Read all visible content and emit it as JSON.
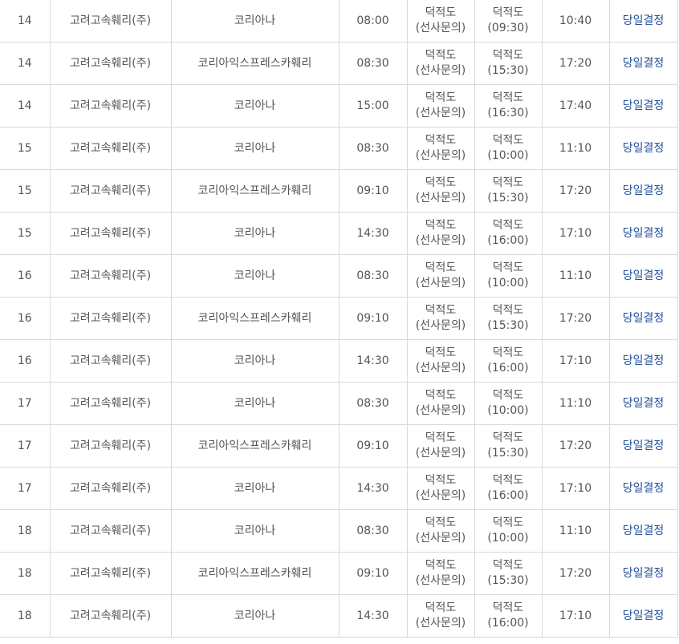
{
  "rows": [
    {
      "day": "14",
      "company": "고려고속훼리(주)",
      "ship": "코리아나",
      "depart": "08:00",
      "route_line1": "덕적도",
      "route_line2": "(선사문의)",
      "stop_line1": "덕적도",
      "stop_line2": "(09:30)",
      "return_time": "10:40",
      "note": "당일결정"
    },
    {
      "day": "14",
      "company": "고려고속훼리(주)",
      "ship": "코리아익스프레스카훼리",
      "depart": "08:30",
      "route_line1": "덕적도",
      "route_line2": "(선사문의)",
      "stop_line1": "덕적도",
      "stop_line2": "(15:30)",
      "return_time": "17:20",
      "note": "당일결정"
    },
    {
      "day": "14",
      "company": "고려고속훼리(주)",
      "ship": "코리아나",
      "depart": "15:00",
      "route_line1": "덕적도",
      "route_line2": "(선사문의)",
      "stop_line1": "덕적도",
      "stop_line2": "(16:30)",
      "return_time": "17:40",
      "note": "당일결정"
    },
    {
      "day": "15",
      "company": "고려고속훼리(주)",
      "ship": "코리아나",
      "depart": "08:30",
      "route_line1": "덕적도",
      "route_line2": "(선사문의)",
      "stop_line1": "덕적도",
      "stop_line2": "(10:00)",
      "return_time": "11:10",
      "note": "당일결정"
    },
    {
      "day": "15",
      "company": "고려고속훼리(주)",
      "ship": "코리아익스프레스카훼리",
      "depart": "09:10",
      "route_line1": "덕적도",
      "route_line2": "(선사문의)",
      "stop_line1": "덕적도",
      "stop_line2": "(15:30)",
      "return_time": "17:20",
      "note": "당일결정"
    },
    {
      "day": "15",
      "company": "고려고속훼리(주)",
      "ship": "코리아나",
      "depart": "14:30",
      "route_line1": "덕적도",
      "route_line2": "(선사문의)",
      "stop_line1": "덕적도",
      "stop_line2": "(16:00)",
      "return_time": "17:10",
      "note": "당일결정"
    },
    {
      "day": "16",
      "company": "고려고속훼리(주)",
      "ship": "코리아나",
      "depart": "08:30",
      "route_line1": "덕적도",
      "route_line2": "(선사문의)",
      "stop_line1": "덕적도",
      "stop_line2": "(10:00)",
      "return_time": "11:10",
      "note": "당일결정"
    },
    {
      "day": "16",
      "company": "고려고속훼리(주)",
      "ship": "코리아익스프레스카훼리",
      "depart": "09:10",
      "route_line1": "덕적도",
      "route_line2": "(선사문의)",
      "stop_line1": "덕적도",
      "stop_line2": "(15:30)",
      "return_time": "17:20",
      "note": "당일결정"
    },
    {
      "day": "16",
      "company": "고려고속훼리(주)",
      "ship": "코리아나",
      "depart": "14:30",
      "route_line1": "덕적도",
      "route_line2": "(선사문의)",
      "stop_line1": "덕적도",
      "stop_line2": "(16:00)",
      "return_time": "17:10",
      "note": "당일결정"
    },
    {
      "day": "17",
      "company": "고려고속훼리(주)",
      "ship": "코리아나",
      "depart": "08:30",
      "route_line1": "덕적도",
      "route_line2": "(선사문의)",
      "stop_line1": "덕적도",
      "stop_line2": "(10:00)",
      "return_time": "11:10",
      "note": "당일결정"
    },
    {
      "day": "17",
      "company": "고려고속훼리(주)",
      "ship": "코리아익스프레스카훼리",
      "depart": "09:10",
      "route_line1": "덕적도",
      "route_line2": "(선사문의)",
      "stop_line1": "덕적도",
      "stop_line2": "(15:30)",
      "return_time": "17:20",
      "note": "당일결정"
    },
    {
      "day": "17",
      "company": "고려고속훼리(주)",
      "ship": "코리아나",
      "depart": "14:30",
      "route_line1": "덕적도",
      "route_line2": "(선사문의)",
      "stop_line1": "덕적도",
      "stop_line2": "(16:00)",
      "return_time": "17:10",
      "note": "당일결정"
    },
    {
      "day": "18",
      "company": "고려고속훼리(주)",
      "ship": "코리아나",
      "depart": "08:30",
      "route_line1": "덕적도",
      "route_line2": "(선사문의)",
      "stop_line1": "덕적도",
      "stop_line2": "(10:00)",
      "return_time": "11:10",
      "note": "당일결정"
    },
    {
      "day": "18",
      "company": "고려고속훼리(주)",
      "ship": "코리아익스프레스카훼리",
      "depart": "09:10",
      "route_line1": "덕적도",
      "route_line2": "(선사문의)",
      "stop_line1": "덕적도",
      "stop_line2": "(15:30)",
      "return_time": "17:20",
      "note": "당일결정"
    },
    {
      "day": "18",
      "company": "고려고속훼리(주)",
      "ship": "코리아나",
      "depart": "14:30",
      "route_line1": "덕적도",
      "route_line2": "(선사문의)",
      "stop_line1": "덕적도",
      "stop_line2": "(16:00)",
      "return_time": "17:10",
      "note": "당일결정"
    }
  ]
}
